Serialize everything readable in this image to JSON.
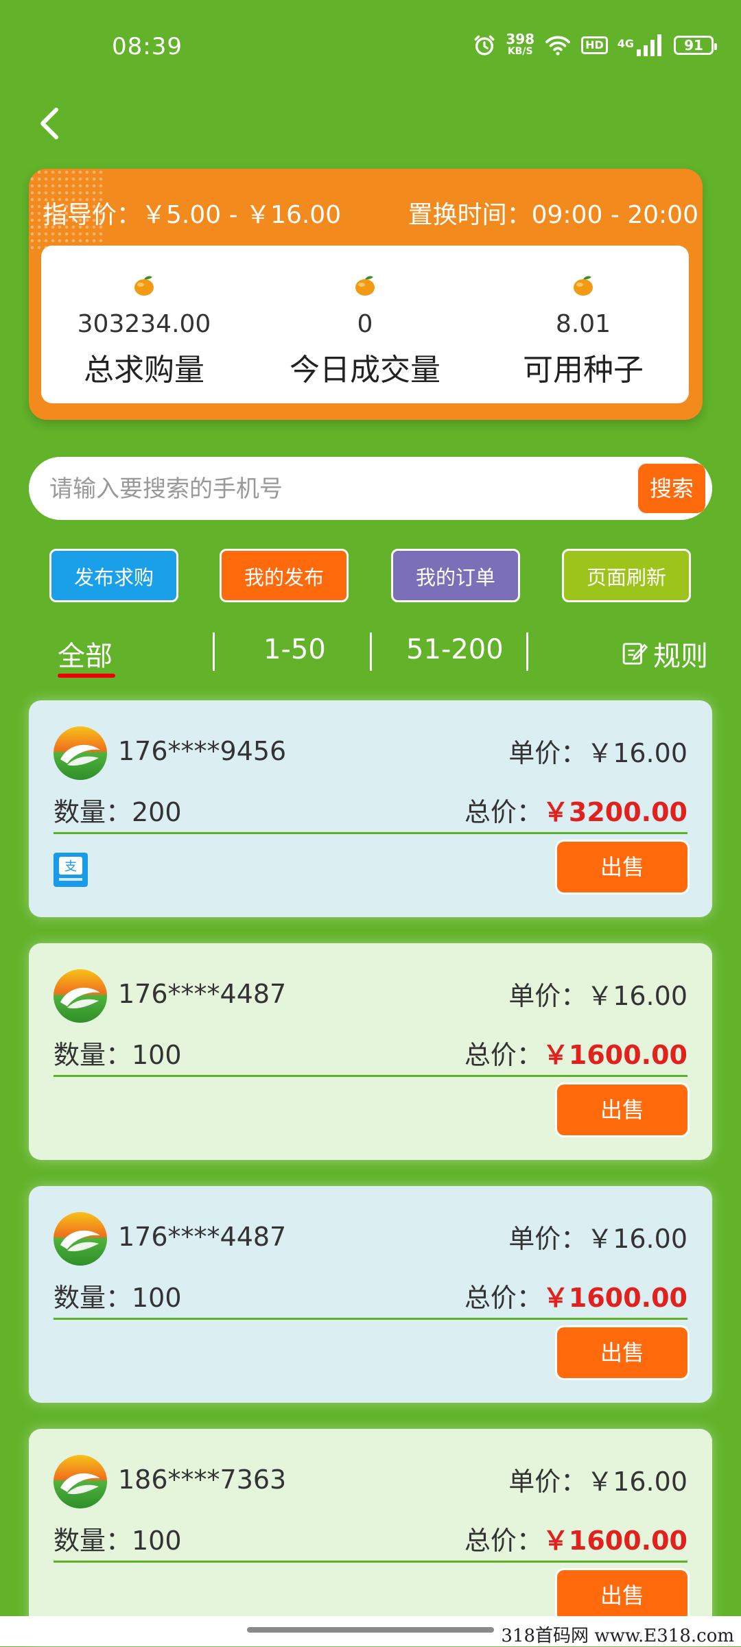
{
  "status_bar": {
    "time": "08:39",
    "speed_value": "398",
    "speed_unit": "KB/S",
    "hd": "HD",
    "network": "4G",
    "battery": "91"
  },
  "header": {
    "guide_price": "指导价：￥5.00 - ￥16.00",
    "swap_time": "置换时间：09:00 - 20:00",
    "stats": [
      {
        "value": "303234.00",
        "label": "总求购量",
        "icon": "orange-fruit-icon"
      },
      {
        "value": "0",
        "label": "今日成交量",
        "icon": "orange-fruit-icon"
      },
      {
        "value": "8.01",
        "label": "可用种子",
        "icon": "orange-fruit-icon"
      }
    ]
  },
  "search": {
    "placeholder": "请输入要搜索的手机号",
    "button": "搜索"
  },
  "actions": [
    {
      "label": "发布求购",
      "color": "#1aa0e8"
    },
    {
      "label": "我的发布",
      "color": "#ff6a0d"
    },
    {
      "label": "我的订单",
      "color": "#7b6fb8"
    },
    {
      "label": "页面刷新",
      "color": "#9dc41a"
    }
  ],
  "tabs": {
    "items": [
      "全部",
      "1-50",
      "51-200"
    ],
    "active": "全部",
    "rules": "规则"
  },
  "orders": [
    {
      "phone": "176****9456",
      "unit_price": "单价：￥16.00",
      "qty": "数量：200",
      "total_label": "总价：",
      "total_amount": "￥3200.00",
      "sell": "出售",
      "has_pay_icon": true
    },
    {
      "phone": "176****4487",
      "unit_price": "单价：￥16.00",
      "qty": "数量：100",
      "total_label": "总价：",
      "total_amount": "￥1600.00",
      "sell": "出售",
      "has_pay_icon": false
    },
    {
      "phone": "176****4487",
      "unit_price": "单价：￥16.00",
      "qty": "数量：100",
      "total_label": "总价：",
      "total_amount": "￥1600.00",
      "sell": "出售",
      "has_pay_icon": false
    },
    {
      "phone": "186****7363",
      "unit_price": "单价：￥16.00",
      "qty": "数量：100",
      "total_label": "总价：",
      "total_amount": "￥1600.00",
      "sell": "出售",
      "has_pay_icon": false
    }
  ],
  "watermark": "318首码网  www.E318.com",
  "colors": {
    "background": "#62b32a",
    "card_orange": "#f28a1e",
    "accent": "#ff6a0d",
    "price_red": "#e0211e"
  }
}
